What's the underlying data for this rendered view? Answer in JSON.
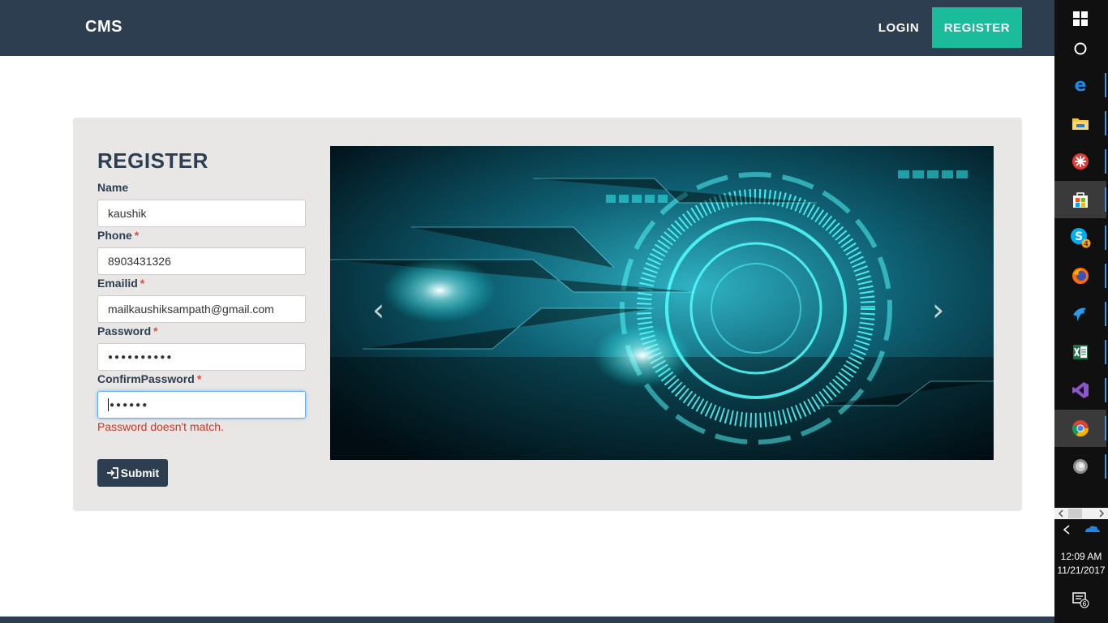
{
  "navbar": {
    "brand": "CMS",
    "login": "LOGIN",
    "register": "REGISTER"
  },
  "form": {
    "title": "REGISTER",
    "name_label": "Name",
    "name_value": "kaushik",
    "phone_label": "Phone",
    "phone_value": "8903431326",
    "email_label": "Emailid",
    "email_value": "mailkaushiksampath@gmail.com",
    "password_label": "Password",
    "password_value": "●●●●●●●●●●",
    "confirm_label": "ConfirmPassword",
    "confirm_value": "●●●●●●",
    "required_marker": "*",
    "error": "Password doesn't match.",
    "submit": "Submit"
  },
  "carousel": {
    "prev": "‹",
    "next": "›"
  },
  "colors": {
    "navbar": "#2c3e50",
    "accent": "#1abc9c",
    "error": "#c0392b",
    "card": "#e8e7e5"
  },
  "taskbar": {
    "icons": [
      "windows-icon",
      "cortana-icon",
      "edge-icon",
      "file-explorer-icon",
      "app-icon",
      "store-icon",
      "skype-icon",
      "firefox-icon",
      "app-icon",
      "excel-icon",
      "visual-studio-icon",
      "chrome-icon",
      "app-icon"
    ],
    "skype_badge": "4",
    "time": "12:09 AM",
    "date": "11/21/2017",
    "notification_count": "6"
  }
}
